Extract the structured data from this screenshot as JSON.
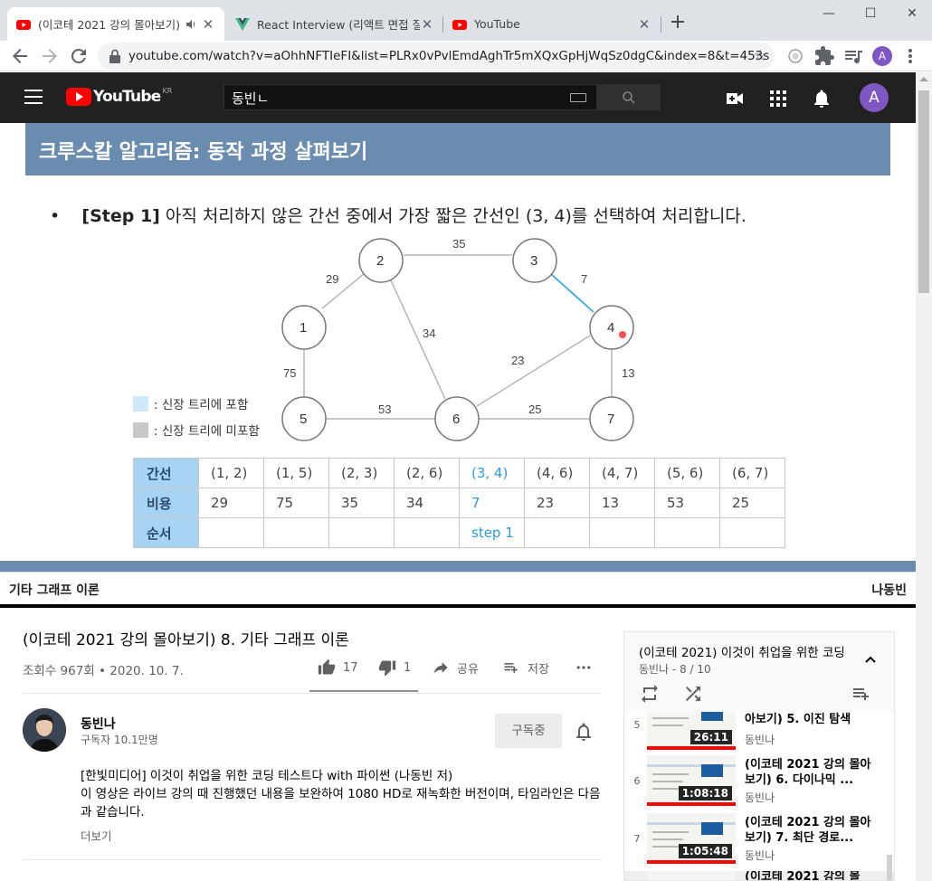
{
  "browser": {
    "tabs": [
      {
        "title": "(이코테 2021 강의 몰아보기)",
        "active": true
      },
      {
        "title": "React Interview (리액트 면접 질",
        "active": false
      },
      {
        "title": "YouTube",
        "active": false
      }
    ],
    "url": "youtube.com/watch?v=aOhhNFTIeFI&list=PLRx0vPvlEmdAghTr5mXQxGpHjWqSz0dgC&index=8&t=453s",
    "profile_initial": "A"
  },
  "youtube": {
    "logo_text": "YouTube",
    "region": "KR",
    "search_value": "동빈ㄴ",
    "avatar_initial": "A"
  },
  "slide": {
    "title": "크루스칼 알고리즘: 동작 과정 살펴보기",
    "bullet": "•",
    "step_label": "[Step 1]",
    "step_text": " 아직 처리하지 않은 간선 중에서 가장 짧은 간선인 (3, 4)를 선택하여 처리합니다.",
    "legend_included": ": 신장 트리에 포함",
    "legend_excluded": ": 신장 트리에 미포함",
    "nodes": [
      "1",
      "2",
      "3",
      "4",
      "5",
      "6",
      "7"
    ],
    "edge_labels": [
      "35",
      "29",
      "7",
      "34",
      "23",
      "75",
      "13",
      "53",
      "25"
    ],
    "table": {
      "row_headers": [
        "간선",
        "비용",
        "순서"
      ],
      "edges": [
        "(1, 2)",
        "(1, 5)",
        "(2, 3)",
        "(2, 6)",
        "(3, 4)",
        "(4, 6)",
        "(4, 7)",
        "(5, 6)",
        "(6, 7)"
      ],
      "costs": [
        "29",
        "75",
        "35",
        "34",
        "7",
        "23",
        "13",
        "53",
        "25"
      ],
      "order": [
        "",
        "",
        "",
        "",
        "step 1",
        "",
        "",
        "",
        ""
      ]
    },
    "colors": {
      "included": "#cfe8fa",
      "excluded": "#c8c8c8",
      "selected_edge": "#3aa7e0",
      "header": "#6a8caf"
    }
  },
  "video_caption": {
    "left": "기타 그래프 이론",
    "right": "나동빈"
  },
  "video": {
    "title": "(이코테 2021 강의 몰아보기) 8. 기타 그래프 이론",
    "meta": "조회수 967회 • 2020. 10. 7.",
    "likes": "17",
    "dislikes": "1",
    "share_label": "공유",
    "save_label": "저장",
    "like_ratio": 0.94
  },
  "channel": {
    "name": "동빈나",
    "subscribers": "구독자 10.1만명",
    "subscribe_label": "구독중"
  },
  "description": {
    "line1": "[한빛미디어] 이것이 취업을 위한 코딩 테스트다 with 파이썬 (나동빈 저)",
    "line2": "이 영상은 라이브 강의 때 진행했던 내용을 보완하여 1080 HD로 재녹화한 버전이며, 타임라인은 다음과 같습니다.",
    "more": "더보기"
  },
  "playlist": {
    "title": "(이코테 2021) 이것이 취업을 위한 코딩",
    "subtitle": "동빈나 - 8 / 10",
    "items": [
      {
        "index": "5",
        "title": "아보기) 5. 이진 탐색",
        "channel": "동빈나",
        "duration": "26:11"
      },
      {
        "index": "6",
        "title": "(이코테 2021 강의 몰아보기) 6. 다이나믹 ...",
        "channel": "동빈나",
        "duration": "1:08:18"
      },
      {
        "index": "7",
        "title": "(이코테 2021 강의 몰아보기) 7. 최단 경로...",
        "channel": "동빈나",
        "duration": "1:05:48"
      },
      {
        "index": "",
        "title": "(이코테 2021 강의 몰",
        "channel": "",
        "duration": ""
      }
    ]
  }
}
